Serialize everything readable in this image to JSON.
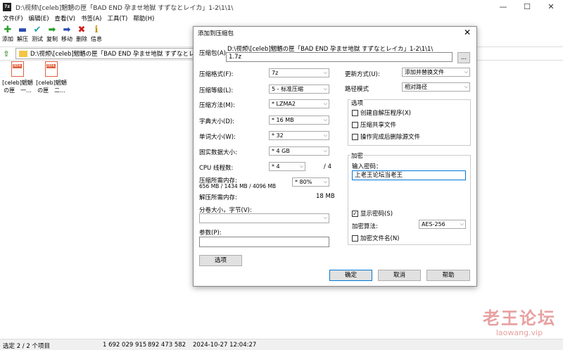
{
  "window": {
    "title": "D:\\视频\\[celeb]魍魉の匣「BAD END 孕ませ地獄 すずなとレイカ」1-2\\1\\1\\",
    "app_icon": "7z",
    "controls": [
      "—",
      "☐",
      "✕"
    ]
  },
  "menu": [
    "文件(F)",
    "编辑(E)",
    "查看(V)",
    "书签(A)",
    "工具(T)",
    "帮助(H)"
  ],
  "toolbar": [
    {
      "label": "添加",
      "icon": "add-icon",
      "glyph": "✚",
      "color": "#2aa02a"
    },
    {
      "label": "解压",
      "icon": "extract-icon",
      "glyph": "▬",
      "color": "#2a4ab0"
    },
    {
      "label": "测试",
      "icon": "test-icon",
      "glyph": "✔",
      "color": "#2aa0b0"
    },
    {
      "label": "复制",
      "icon": "copy-icon",
      "glyph": "➡",
      "color": "#2aa02a"
    },
    {
      "label": "移动",
      "icon": "move-icon",
      "glyph": "➡",
      "color": "#2a4ab0"
    },
    {
      "label": "删除",
      "icon": "delete-icon",
      "glyph": "✖",
      "color": "#d02020"
    },
    {
      "label": "信息",
      "icon": "info-icon",
      "glyph": "ℹ",
      "color": "#c09010"
    }
  ],
  "address": {
    "path": "D:\\视频\\[celeb]魍魉の匣「BAD END 孕ませ地獄 すずなとレイカ」1"
  },
  "files": [
    {
      "line1": "[celeb]魍魉",
      "line2": "の匣　一..."
    },
    {
      "line1": "[celeb]魍魉",
      "line2": "の匣　二..."
    }
  ],
  "status": {
    "selection": "选定 2 / 2 个项目",
    "size": "1 692 029 915",
    "packed": "892 473 582",
    "modified": "2024-10-27 12:04:27"
  },
  "watermark": {
    "cn": "老王论坛",
    "url": "laowang.vip"
  },
  "dialog": {
    "title": "添加到压缩包",
    "close": "✕",
    "archive_label": "压缩包(A)",
    "archive_path": "D:\\视频\\[celeb]魍魉の匣「BAD END 孕ませ地獄 すずなとレイカ」1-2\\1\\1\\",
    "archive_name": "1.7z",
    "browse": "...",
    "format_label": "压缩格式(F):",
    "format_value": "7z",
    "level_label": "压缩等级(L):",
    "level_value": "5 - 标准压缩",
    "method_label": "压缩方法(M):",
    "method_value": "* LZMA2",
    "dict_label": "字典大小(D):",
    "dict_value": "* 16 MB",
    "word_label": "单词大小(W):",
    "word_value": "* 32",
    "solid_label": "固实数据大小:",
    "solid_value": "* 4 GB",
    "threads_label": "CPU 线程数:",
    "threads_value": "* 4",
    "threads_max": "/ 4",
    "mem_comp_label": "压缩所需内存:",
    "mem_comp_value": "656 MB / 1434 MB / 4096 MB",
    "mem_comp_pct": "* 80%",
    "mem_decomp_label": "解压所需内存:",
    "mem_decomp_value": "18 MB",
    "split_label": "分卷大小，字节(V):",
    "split_value": "",
    "params_label": "参数(P):",
    "params_value": "",
    "options_button": "选项",
    "update_label": "更新方式(U):",
    "update_value": "添加并替换文件",
    "path_label": "路径模式",
    "path_value": "相对路径",
    "options_group": "选项",
    "opt_sfx": "创建自解压程序(X)",
    "opt_shared": "压缩共享文件",
    "opt_delete": "操作完成后删除源文件",
    "enc_group": "加密",
    "password_label": "输入密码：",
    "password_value": "上老王论坛当老王",
    "show_password": "显示密码(S)",
    "enc_method_label": "加密算法:",
    "enc_method_value": "AES-256",
    "encrypt_names": "加密文件名(N)",
    "ok": "确定",
    "cancel": "取消",
    "help": "帮助"
  }
}
